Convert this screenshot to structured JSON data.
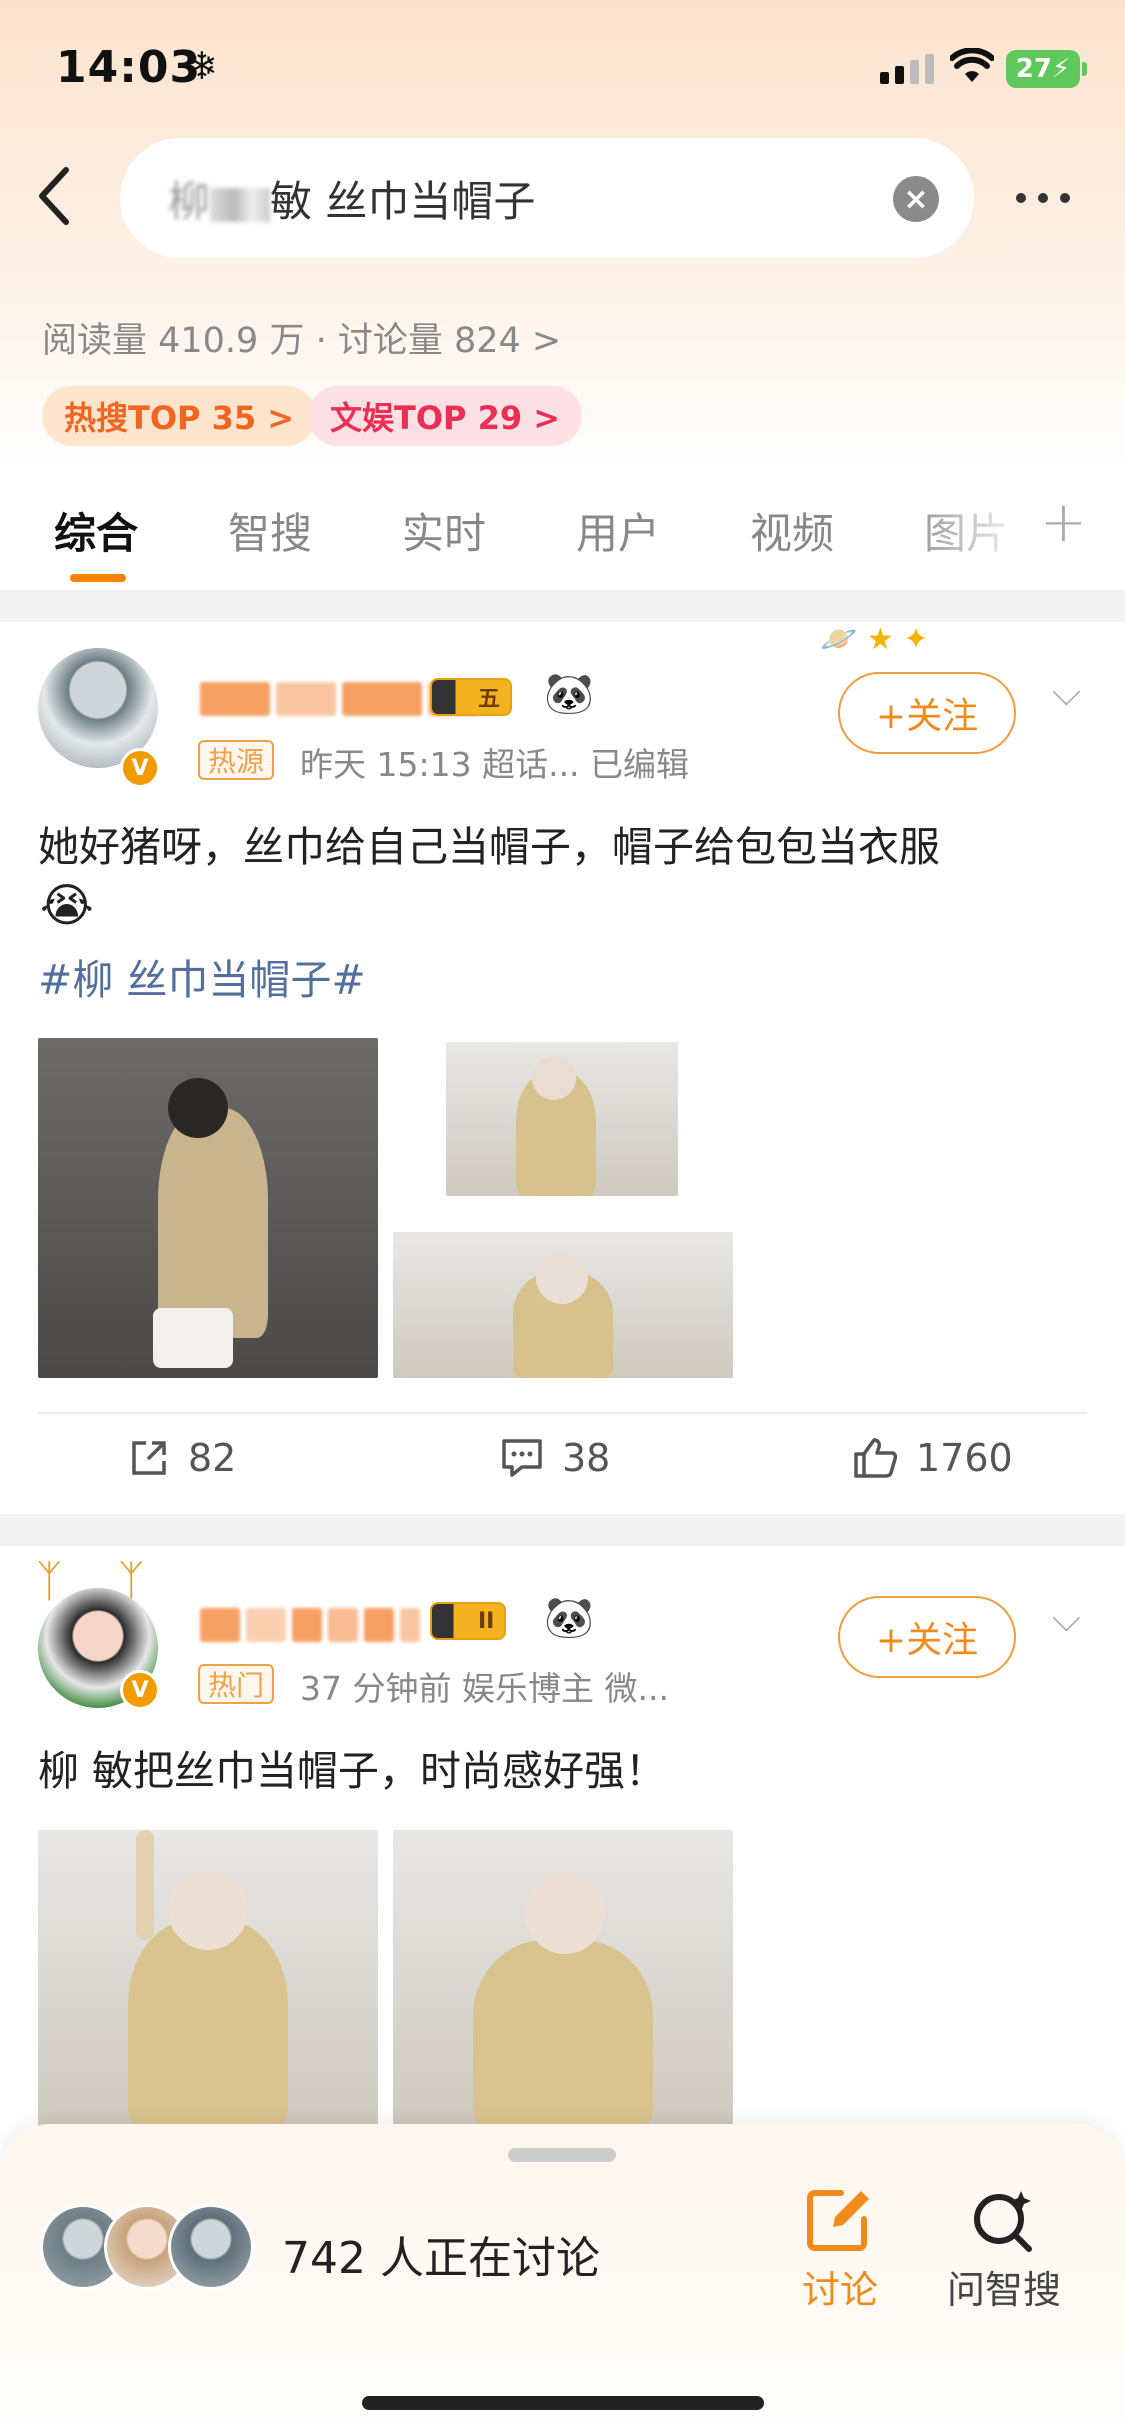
{
  "status_bar": {
    "time": "14:03",
    "snow_icon": "❄",
    "battery": "27"
  },
  "search": {
    "query_visible": "敏 丝巾当帽子",
    "query_prefix": "柳"
  },
  "stats": "阅读量 410.9 万 · 讨论量 824 >",
  "badges": {
    "hot": "热搜TOP 35 >",
    "ent": "文娱TOP 29 >"
  },
  "tabs": [
    "综合",
    "智搜",
    "实时",
    "用户",
    "视频",
    "图片"
  ],
  "posts": [
    {
      "tag": "热源",
      "meta": "昨天 15:13  超话...  已编辑",
      "follow": "+关注",
      "text": "她好猪呀，丝巾给自己当帽子，帽子给包包当衣服",
      "emoji": "😭",
      "hashtag": "#柳     丝巾当帽子#",
      "level": "五",
      "actions": {
        "repost": "82",
        "comment": "38",
        "like": "1760"
      }
    },
    {
      "tag": "热门",
      "meta": "37 分钟前  娱乐博主 微...",
      "follow": "+关注",
      "text": "柳   敏把丝巾当帽子，时尚感好强！",
      "level": "II"
    }
  ],
  "bottom_sheet": {
    "discussing": "742 人正在讨论",
    "discuss_label": "讨论",
    "ask_label": "问智搜"
  },
  "colors": {
    "accent": "#ff8200",
    "follow": "#f08a1a",
    "hashtag": "#536f9c"
  }
}
